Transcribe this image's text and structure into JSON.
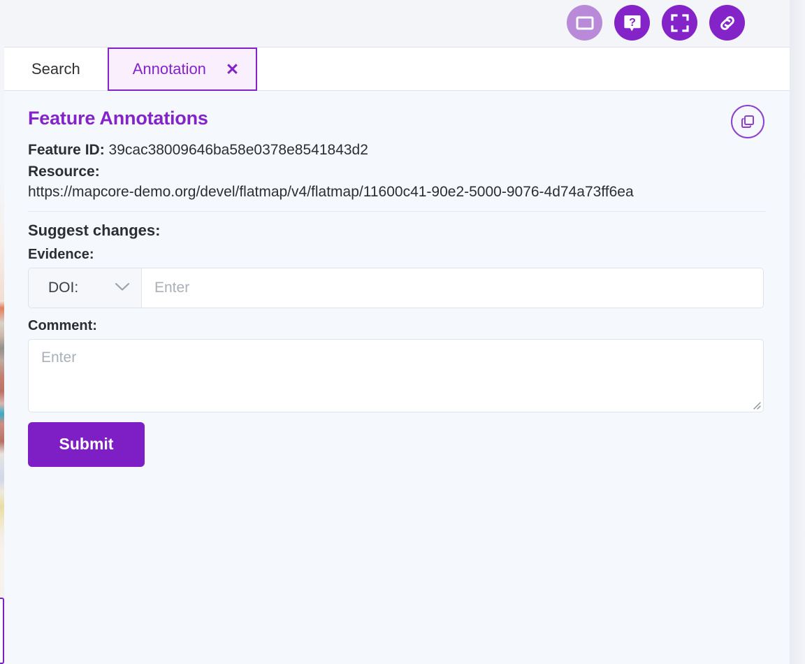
{
  "toolbar": {
    "icons": [
      {
        "name": "minimise-window-icon",
        "label": "Minimise window",
        "style": "light"
      },
      {
        "name": "help-icon",
        "label": "Help",
        "style": "solid"
      },
      {
        "name": "fullscreen-icon",
        "label": "Fullscreen",
        "style": "solid"
      },
      {
        "name": "link-icon",
        "label": "Copy link",
        "style": "solid"
      }
    ]
  },
  "tabs": [
    {
      "label": "Search",
      "active": false
    },
    {
      "label": "Annotation",
      "active": true,
      "close": "✕"
    }
  ],
  "panel": {
    "title": "Feature Annotations",
    "copy_icon": "copy-icon",
    "feature_id_label": "Feature ID:",
    "feature_id_value": "39cac38009646ba58e0378e8541843d2",
    "resource_label": "Resource:",
    "resource_value": "https://mapcore-demo.org/devel/flatmap/v4/flatmap/11600c41-90e2-5000-9076-4d74a73ff6ea",
    "suggest_changes_label": "Suggest changes:",
    "evidence_label": "Evidence:",
    "evidence_select_value": "DOI:",
    "evidence_input_placeholder": "Enter",
    "evidence_input_value": "",
    "comment_label": "Comment:",
    "comment_placeholder": "Enter",
    "comment_value": "",
    "submit_label": "Submit"
  },
  "colors": {
    "accent": "#8323c8",
    "accent_dark": "#7d1fc4",
    "accent_light": "#b98ad8",
    "tab_active_bg": "#faf0fd",
    "panel_bg": "#f5f8fd",
    "toolbar_bg": "#f3f5f9",
    "text": "#2b2f33",
    "placeholder": "#a9b0ba"
  }
}
